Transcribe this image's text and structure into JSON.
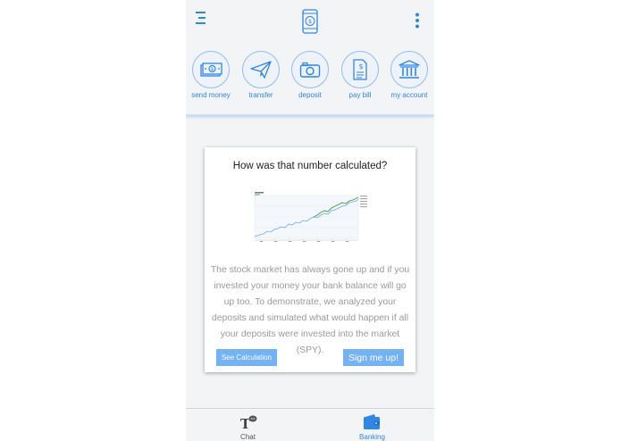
{
  "header": {
    "menu_icon": "menu-icon",
    "logo_icon": "phone-logo-icon",
    "more_icon": "kebab-menu-icon"
  },
  "actions": [
    {
      "label": "send money",
      "icon": "cash-icon"
    },
    {
      "label": "transfer",
      "icon": "paper-plane-icon"
    },
    {
      "label": "deposit",
      "icon": "camera-icon"
    },
    {
      "label": "pay bill",
      "icon": "bill-icon"
    },
    {
      "label": "my account",
      "icon": "bank-icon"
    }
  ],
  "card": {
    "title": "How was that number calculated?",
    "body": "The stock market has always gone up and if you invested your money your bank balance will go up too. To demonstrate, we analyzed your deposits and simulated what would happen if all your deposits were invested into the market (SPY).",
    "see_calculation": "See Calculation",
    "sign_up": "Sign me up!"
  },
  "tabs": [
    {
      "label": "Chat",
      "icon": "chat-icon",
      "active": false
    },
    {
      "label": "Banking",
      "icon": "wallet-icon",
      "active": true
    }
  ],
  "colors": {
    "accent": "#2f86e6",
    "button": "#72b2f5",
    "background": "#f3f4f6",
    "body_text": "#9a9a9a"
  }
}
